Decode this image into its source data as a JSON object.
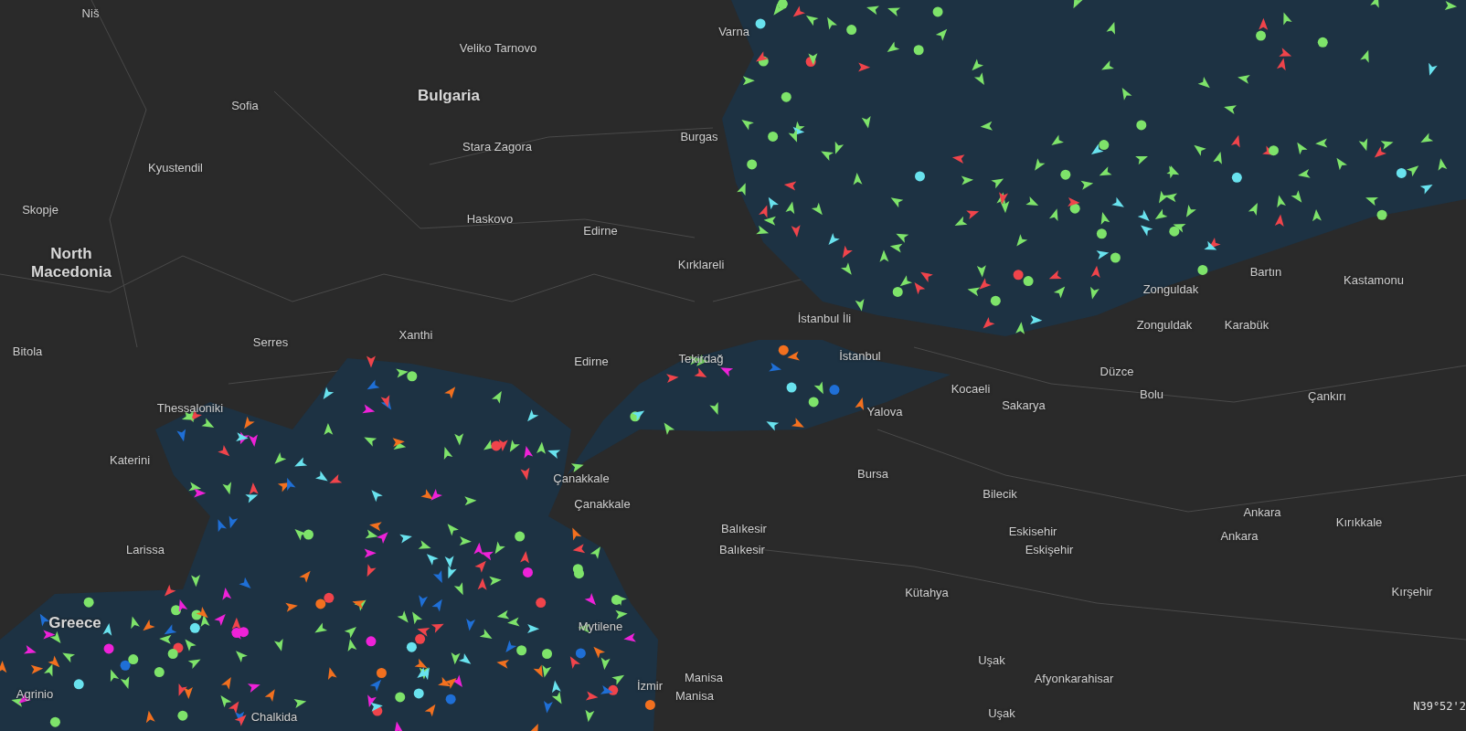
{
  "map": {
    "labels": [
      {
        "text": "Niš",
        "kind": "city"
      },
      {
        "text": "Veliko Tarnovo",
        "kind": "city"
      },
      {
        "text": "Bulgaria",
        "kind": "country"
      },
      {
        "text": "Sofia",
        "kind": "city"
      },
      {
        "text": "Stara Zagora",
        "kind": "city"
      },
      {
        "text": "Kyustendil",
        "kind": "city"
      },
      {
        "text": "Skopje",
        "kind": "city"
      },
      {
        "text": "Haskovo",
        "kind": "city"
      },
      {
        "text": "North Macedonia",
        "kind": "country"
      },
      {
        "text": "Edirne",
        "kind": "city"
      },
      {
        "text": "Kırklareli",
        "kind": "city"
      },
      {
        "text": "Serres",
        "kind": "city"
      },
      {
        "text": "Xanthi",
        "kind": "city"
      },
      {
        "text": "Bitola",
        "kind": "city"
      },
      {
        "text": "Edirne",
        "kind": "city"
      },
      {
        "text": "Tekirdağ",
        "kind": "city"
      },
      {
        "text": "İstanbul İli",
        "kind": "city"
      },
      {
        "text": "İstanbul",
        "kind": "city"
      },
      {
        "text": "Varna",
        "kind": "city"
      },
      {
        "text": "Burgas",
        "kind": "city"
      },
      {
        "text": "Zonguldak",
        "kind": "city"
      },
      {
        "text": "Zonguldak",
        "kind": "city"
      },
      {
        "text": "Bartın",
        "kind": "city"
      },
      {
        "text": "Kastamonu",
        "kind": "city"
      },
      {
        "text": "Karabük",
        "kind": "city"
      },
      {
        "text": "Düzce",
        "kind": "city"
      },
      {
        "text": "Kocaeli",
        "kind": "city"
      },
      {
        "text": "Sakarya",
        "kind": "city"
      },
      {
        "text": "Bolu",
        "kind": "city"
      },
      {
        "text": "Yalova",
        "kind": "city"
      },
      {
        "text": "Çankırı",
        "kind": "city"
      },
      {
        "text": "Thessaloniki",
        "kind": "city"
      },
      {
        "text": "Katerini",
        "kind": "city"
      },
      {
        "text": "Çanakkale",
        "kind": "city"
      },
      {
        "text": "Çanakkale",
        "kind": "city"
      },
      {
        "text": "Bursa",
        "kind": "city"
      },
      {
        "text": "Bilecik",
        "kind": "city"
      },
      {
        "text": "Ankara",
        "kind": "city"
      },
      {
        "text": "Kırıkkale",
        "kind": "city"
      },
      {
        "text": "Larissa",
        "kind": "city"
      },
      {
        "text": "Balıkesir",
        "kind": "city"
      },
      {
        "text": "Balıkesir",
        "kind": "city"
      },
      {
        "text": "Eskisehir",
        "kind": "city"
      },
      {
        "text": "Eskişehir",
        "kind": "city"
      },
      {
        "text": "Ankara",
        "kind": "city"
      },
      {
        "text": "Kütahya",
        "kind": "city"
      },
      {
        "text": "Kırşehir",
        "kind": "city"
      },
      {
        "text": "Greece",
        "kind": "country"
      },
      {
        "text": "Mytilene",
        "kind": "city"
      },
      {
        "text": "Manisa",
        "kind": "city"
      },
      {
        "text": "Manisa",
        "kind": "city"
      },
      {
        "text": "Uşak",
        "kind": "city"
      },
      {
        "text": "Afyonkarahisar",
        "kind": "city"
      },
      {
        "text": "Uşak",
        "kind": "city"
      },
      {
        "text": "İzmir",
        "kind": "city"
      },
      {
        "text": "Agrinio",
        "kind": "city"
      },
      {
        "text": "Chalkida",
        "kind": "city"
      }
    ]
  },
  "coordinates": "N39°52'2"
}
